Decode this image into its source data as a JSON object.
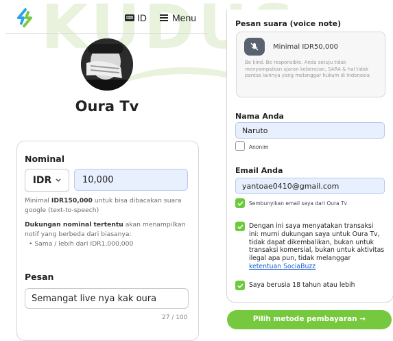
{
  "watermark": {
    "text": "KUDUS"
  },
  "header": {
    "lang_label": "ID",
    "menu_label": "Menu"
  },
  "profile": {
    "name": "Oura Tv"
  },
  "donation": {
    "nominal_label": "Nominal",
    "currency": "IDR",
    "amount": "10,000",
    "tts_note_prefix": "Minimal ",
    "tts_note_bold": "IDR150,000",
    "tts_note_suffix": " untuk bisa dibacakan suara google (text-to-speech)",
    "special_bold": "Dukungan nominal tertentu",
    "special_rest": " akan menampilkan notif yang berbeda dari biasanya:",
    "special_item": "Sama / lebih dari IDR1,000,000",
    "message_label": "Pesan",
    "message_value": "Semangat live nya kak oura",
    "counter": "27 / 100"
  },
  "voice": {
    "label": "Pesan suara (voice note)",
    "minimum": "Minimal IDR50,000",
    "note": "Be kind. Be responsible. Anda setuju tidak menyampaikan ujaran kebencian, SARA & hal tidak pantas lainnya yang melanggar hukum di Indonesia"
  },
  "form": {
    "name_label": "Nama Anda",
    "name_value": "Naruto",
    "anon_label": "Anonim",
    "email_label": "Email Anda",
    "email_value": "yantoae0410@gmail.com",
    "hide_email_label": "Sembunyikan email saya dari Oura Tv",
    "terms_text": "Dengan ini saya menyatakan transaksi ini: murni dukungan saya untuk Oura Tv, tidak dapat dikembalikan, bukan untuk transaksi komersial, bukan untuk aktivitas ilegal apa pun, tidak melanggar ",
    "terms_link": "ketentuan SociaBuzz",
    "age_label": "Saya berusia 18 tahun atau lebih",
    "anon_checked": false,
    "hide_email_checked": true,
    "terms_checked": true,
    "age_checked": true
  },
  "pay_button": "Pilih metode pembayaran →",
  "colors": {
    "accent_green": "#76c93e",
    "input_fill": "#e8f0fe",
    "link_blue": "#1a5fd0"
  }
}
